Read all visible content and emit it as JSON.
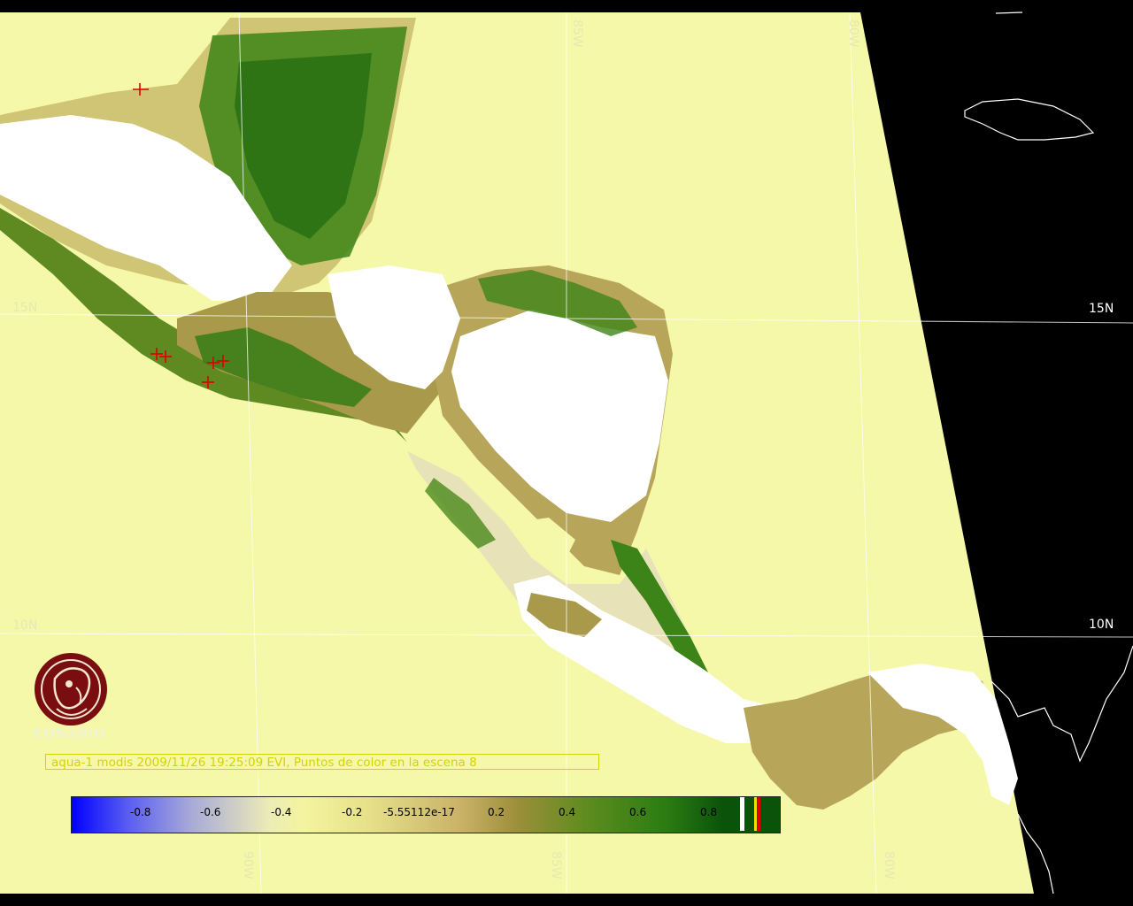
{
  "map": {
    "colors": {
      "ocean": "#f4f8a8",
      "land_sparse": "#e3e39a",
      "land_mid": "#b7a55a",
      "vegetation": "#2e7a12",
      "dense_vegetation": "#0e5a0a",
      "clouds": "#ffffff",
      "no_data": "#000000",
      "fire_marker": "#e00000",
      "caption": "#d6d200"
    },
    "graticule": {
      "lat_left": [
        "15N",
        "10N"
      ],
      "lat_right": [
        "15N",
        "10N"
      ],
      "lon_top": [
        "85W",
        "80W"
      ],
      "lon_bottom": [
        "90W",
        "85W",
        "80W"
      ]
    }
  },
  "logo": {
    "text": "CONABIO",
    "icon": "conabio-logo-icon"
  },
  "caption": "aqua-1 modis 2009/11/26 19:25:09 EVI, Puntos de color en la escena 8",
  "colorbar": {
    "ticks": [
      "-0.8",
      "-0.6",
      "-0.4",
      "-0.2",
      "-5.55112e-17",
      "0.2",
      "0.4",
      "0.6",
      "0.8"
    ]
  }
}
